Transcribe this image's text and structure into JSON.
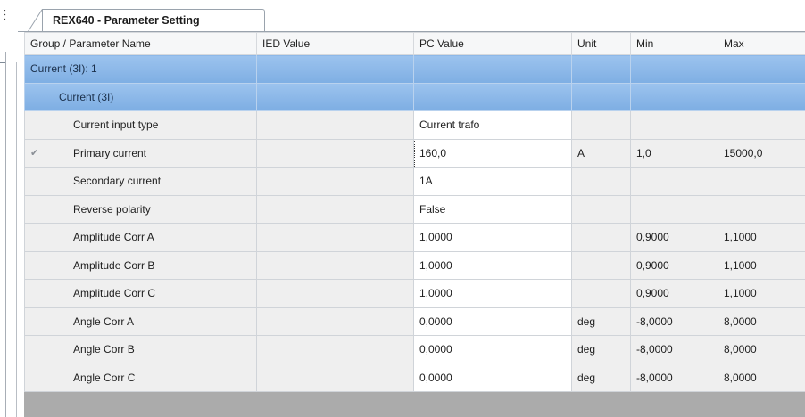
{
  "tab": {
    "title": "REX640 - Parameter Setting"
  },
  "grid": {
    "columns": [
      "Group / Parameter Name",
      "IED Value",
      "PC Value",
      "Unit",
      "Min",
      "Max"
    ],
    "groups": [
      {
        "label": "Current (3I): 1"
      },
      {
        "label": "Current (3I)"
      }
    ],
    "rows": [
      {
        "name": "Current input type",
        "ied": "",
        "pc": "Current trafo",
        "unit": "",
        "min": "",
        "max": ""
      },
      {
        "name": "Primary current",
        "ied": "",
        "pc": "160,0",
        "unit": "A",
        "min": "1,0",
        "max": "15000,0"
      },
      {
        "name": "Secondary current",
        "ied": "",
        "pc": "1A",
        "unit": "",
        "min": "",
        "max": ""
      },
      {
        "name": "Reverse polarity",
        "ied": "",
        "pc": "False",
        "unit": "",
        "min": "",
        "max": ""
      },
      {
        "name": "Amplitude Corr A",
        "ied": "",
        "pc": "1,0000",
        "unit": "",
        "min": "0,9000",
        "max": "1,1000"
      },
      {
        "name": "Amplitude Corr B",
        "ied": "",
        "pc": "1,0000",
        "unit": "",
        "min": "0,9000",
        "max": "1,1000"
      },
      {
        "name": "Amplitude Corr C",
        "ied": "",
        "pc": "1,0000",
        "unit": "",
        "min": "0,9000",
        "max": "1,1000"
      },
      {
        "name": "Angle Corr A",
        "ied": "",
        "pc": "0,0000",
        "unit": "deg",
        "min": "-8,0000",
        "max": "8,0000"
      },
      {
        "name": "Angle Corr B",
        "ied": "",
        "pc": "0,0000",
        "unit": "deg",
        "min": "-8,0000",
        "max": "8,0000"
      },
      {
        "name": "Angle Corr C",
        "ied": "",
        "pc": "0,0000",
        "unit": "deg",
        "min": "-8,0000",
        "max": "8,0000"
      }
    ],
    "modified_marker_icon": "checkmark-icon",
    "colors": {
      "group_row": "#8db8e9",
      "grid_background": "#ababab"
    }
  }
}
